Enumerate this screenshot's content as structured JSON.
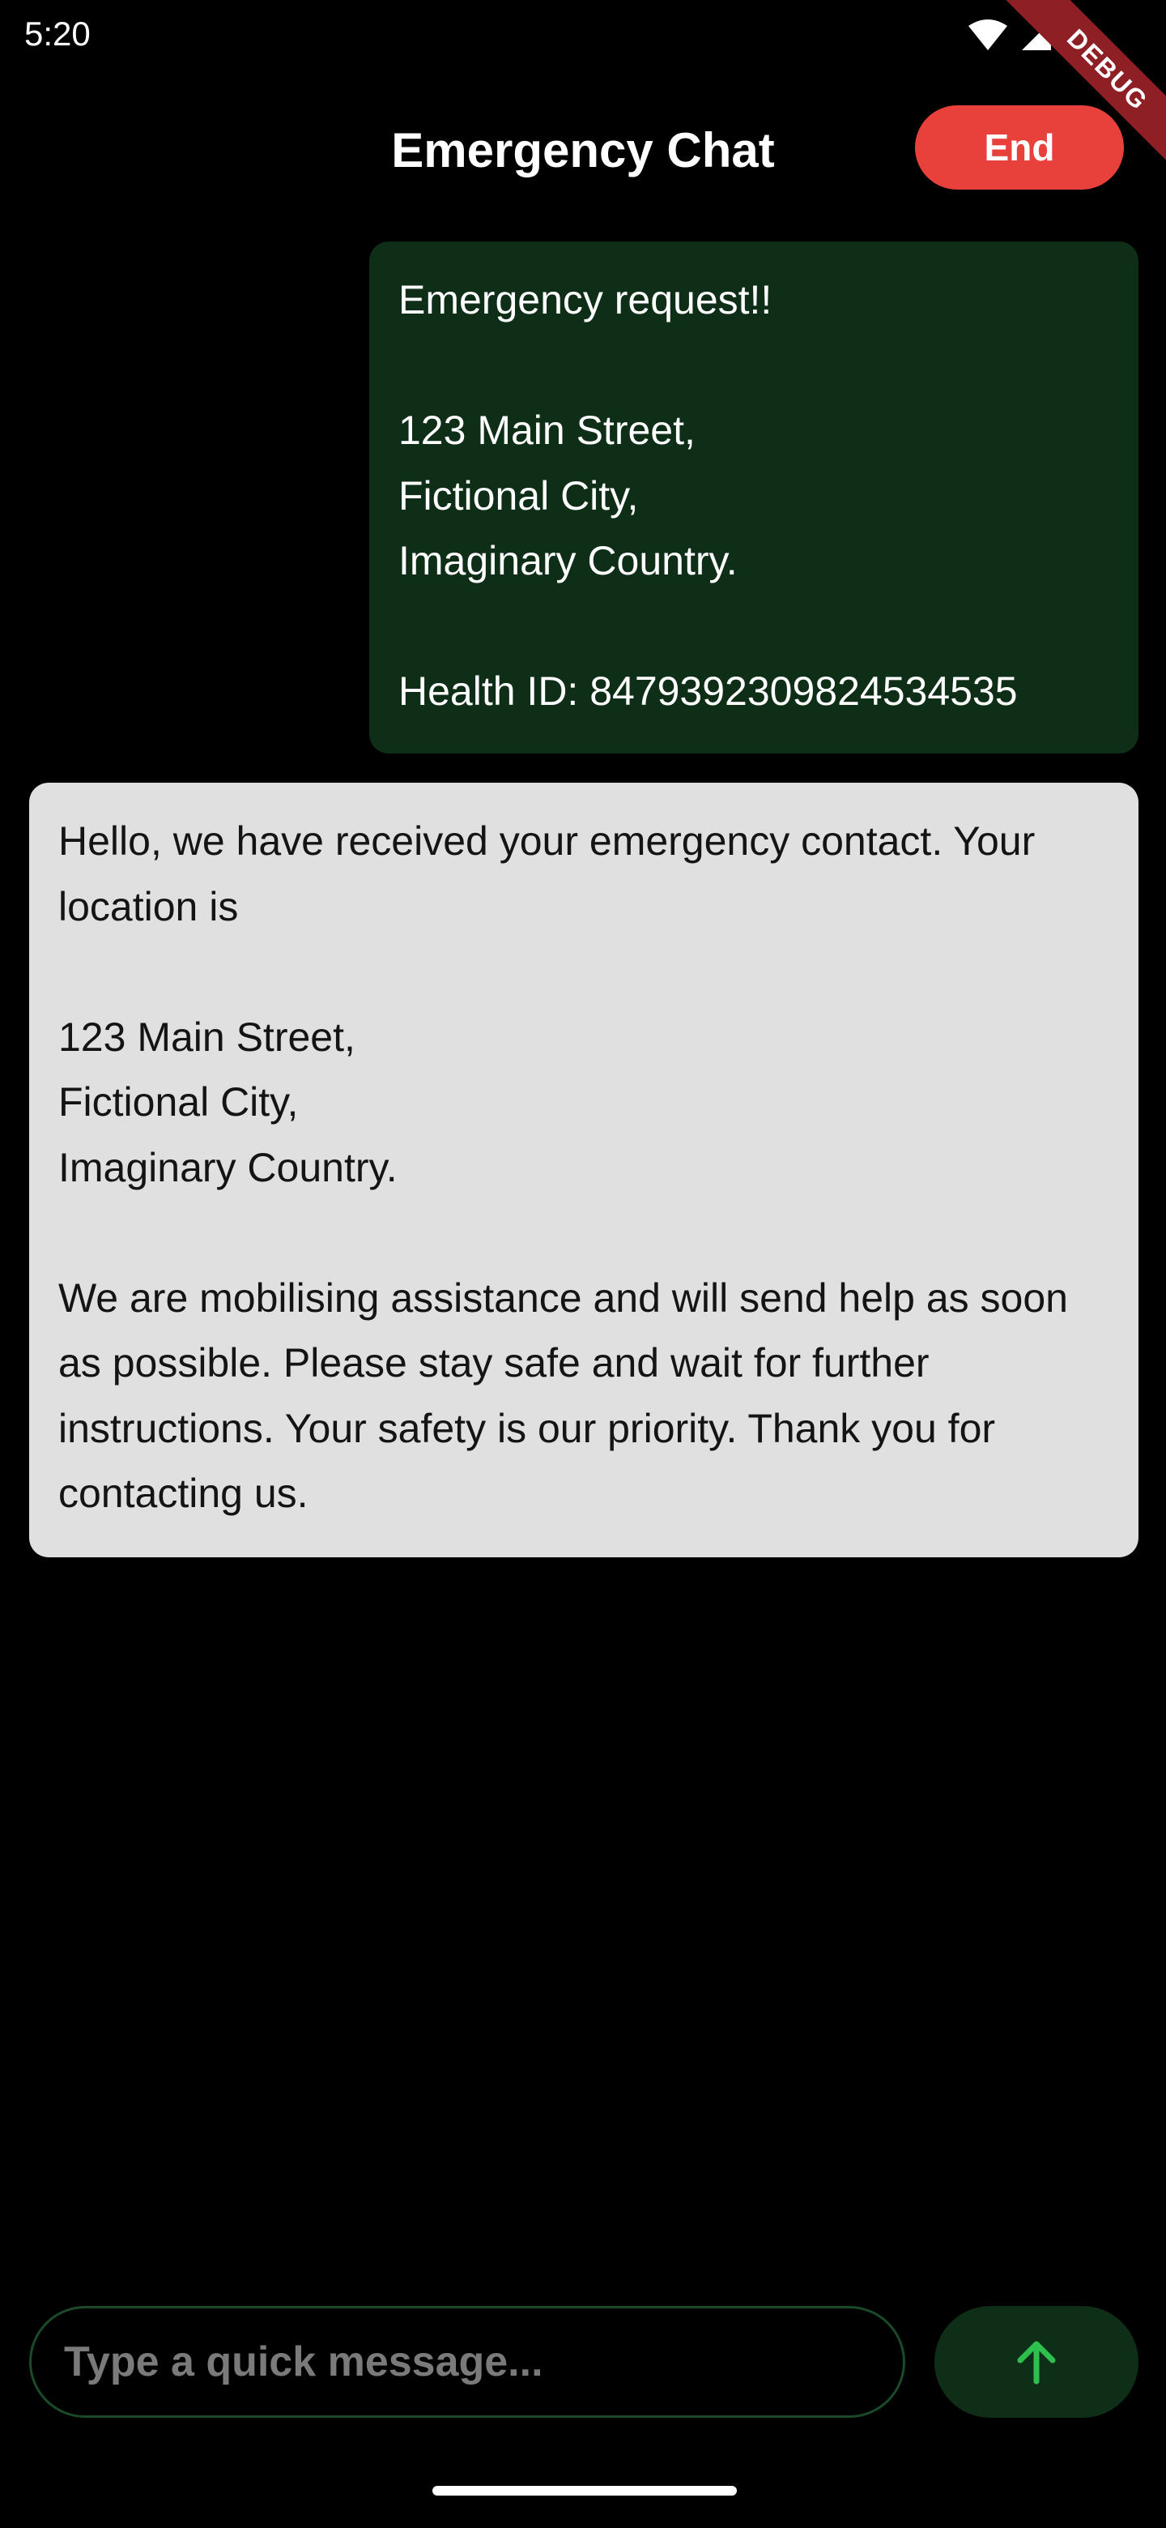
{
  "status_bar": {
    "time": "5:20",
    "icons": [
      "wifi-icon",
      "signal-icon",
      "battery-icon"
    ],
    "debug_banner": "DEBUG"
  },
  "app_bar": {
    "title": "Emergency Chat",
    "end_label": "End"
  },
  "messages": [
    {
      "sender": "user",
      "text": "Emergency request!!\n\n123 Main Street,\nFictional City,\nImaginary Country.\n\nHealth ID: 8479392309824534535"
    },
    {
      "sender": "responder",
      "text": "Hello, we have received your emergency contact. Your location is\n\n123 Main Street,\nFictional City,\nImaginary Country.\n\nWe are mobilising assistance and will send help as soon as possible. Please stay safe and wait for further instructions. Your safety is our priority. Thank you for contacting us."
    }
  ],
  "composer": {
    "placeholder": "Type a quick message...",
    "value": "",
    "send_icon": "arrow-up-icon"
  },
  "colors": {
    "background": "#000000",
    "end_button": "#e8403a",
    "sent_bubble": "#0e2e18",
    "received_bubble": "#e0e0e0",
    "send_arrow": "#2fbf4f",
    "input_border": "#1a4a28"
  }
}
